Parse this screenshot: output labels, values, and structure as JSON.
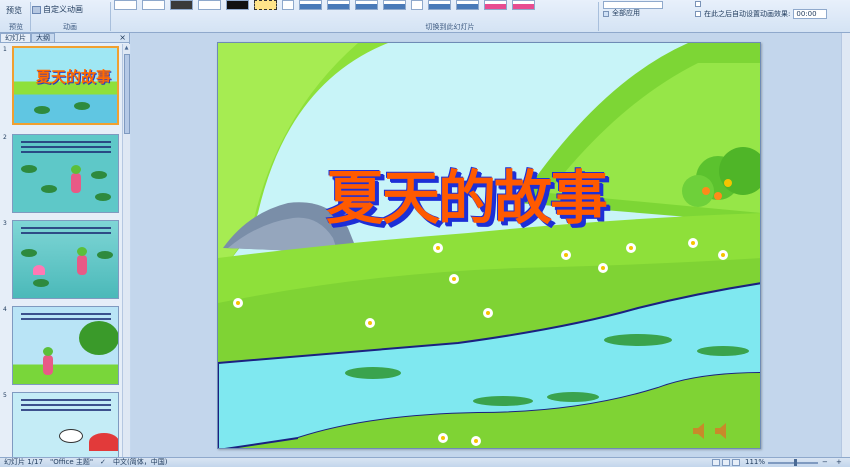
{
  "ribbon": {
    "preview_label": "预览",
    "custom_animation_label": "自定义动画",
    "group_preview": "预览",
    "group_animation": "动画",
    "group_transition": "切换到此幻灯片",
    "apply_all_label": "全部应用",
    "auto_advance_label": "在此之后自动设置动画效果:",
    "auto_advance_value": "00:00"
  },
  "left_pane": {
    "tab_slides": "幻灯片",
    "tab_outline": "大纲",
    "close_label": "×",
    "slide_numbers": [
      "1",
      "2",
      "3",
      "4",
      "5"
    ],
    "first_thumb_title": "夏天的故事"
  },
  "slide": {
    "title": "夏天的故事"
  },
  "status": {
    "slide_position": "幻灯片 1/17",
    "theme": "\"Office 主题\"",
    "language": "中文(简体，中国)",
    "zoom": "111%"
  },
  "colors": {
    "title_fill": "#ff5a00",
    "title_outline": "#1d2fd6",
    "grass": "#8ee03a",
    "river": "#7fe8f0",
    "sky": "#c8f4f8"
  }
}
